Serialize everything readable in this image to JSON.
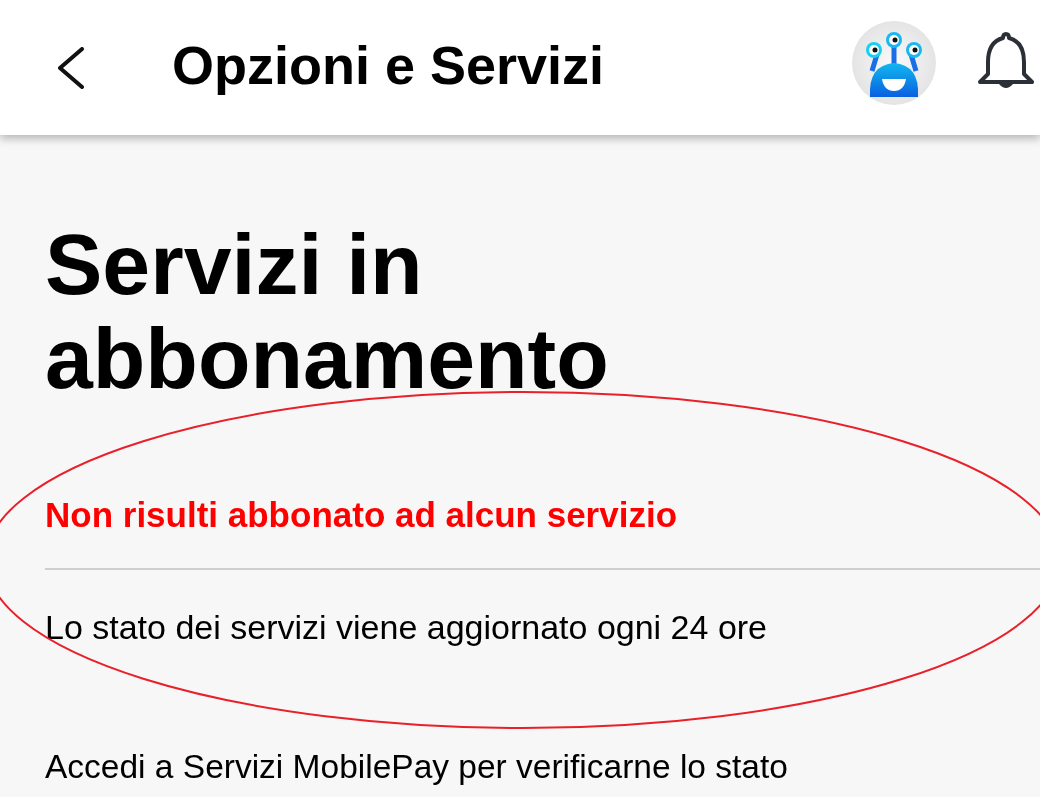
{
  "header": {
    "title": "Opzioni e Servizi"
  },
  "heading": "Servizi in abbonamento",
  "status_message": "Non risulti abbonato ad alcun servizio",
  "update_note": "Lo stato dei servizi viene aggiornato ogni 24 ore",
  "mobilepay_note": "Accedi a Servizi MobilePay per verificarne lo stato",
  "annotation": {
    "kind": "ellipse"
  }
}
